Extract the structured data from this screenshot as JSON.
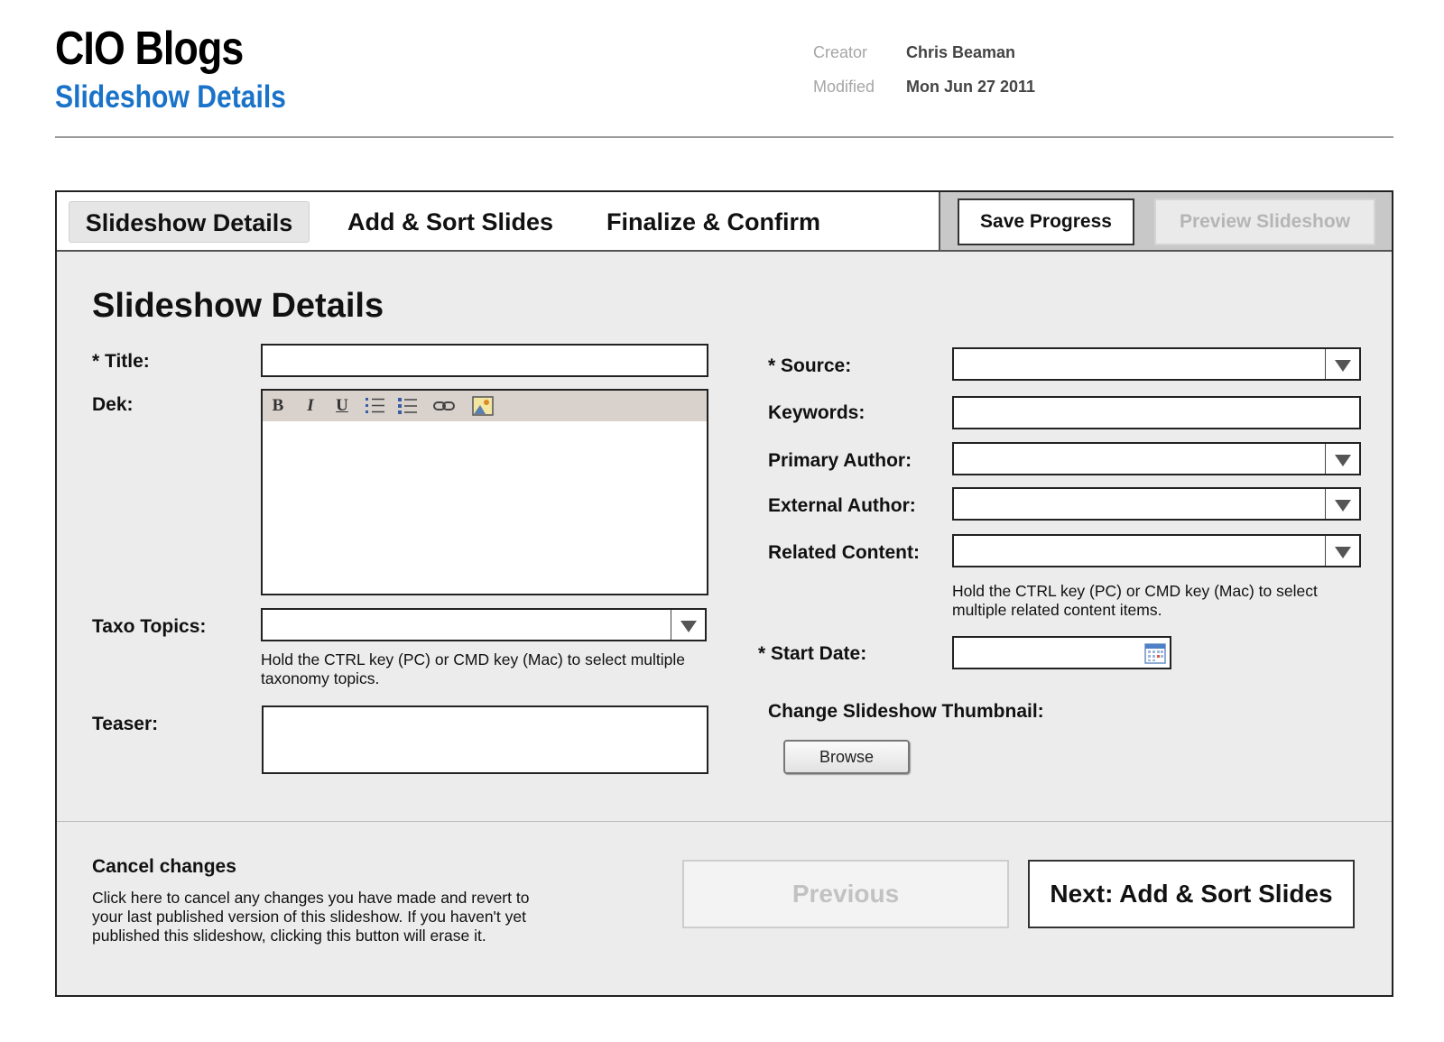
{
  "header": {
    "app_title": "CIO Blogs",
    "page_subtitle": "Slideshow Details",
    "meta": [
      {
        "label": "Creator",
        "value": "Chris Beaman"
      },
      {
        "label": "Modified",
        "value": "Mon Jun 27 2011"
      }
    ]
  },
  "tabs": [
    {
      "label": "Slideshow Details",
      "active": true
    },
    {
      "label": "Add & Sort Slides",
      "active": false
    },
    {
      "label": "Finalize & Confirm",
      "active": false
    }
  ],
  "actions": {
    "save_label": "Save Progress",
    "preview_label": "Preview Slideshow"
  },
  "form": {
    "section_title": "Slideshow Details",
    "left": {
      "title_label": "* Title:",
      "dek_label": "Dek:",
      "rte_tools": {
        "bold": "B",
        "italic": "I",
        "underline": "U"
      },
      "taxo_label": "Taxo Topics:",
      "taxo_hint": "Hold the CTRL key (PC) or CMD key (Mac) to select multiple taxonomy topics.",
      "teaser_label": "Teaser:"
    },
    "right": {
      "source_label": "* Source:",
      "keywords_label": "Keywords:",
      "primary_author_label": "Primary Author:",
      "external_author_label": "External Author:",
      "related_content_label": "Related Content:",
      "related_hint": "Hold the CTRL key (PC) or CMD key (Mac) to select multiple related content items.",
      "start_date_label": "* Start Date:",
      "thumbnail_label": "Change Slideshow Thumbnail:",
      "browse_label": "Browse"
    }
  },
  "footer": {
    "cancel_title": "Cancel changes",
    "cancel_desc": "Click here to cancel any changes you have made and revert to your last published version of this slideshow. If you haven't yet published this slideshow, clicking this button will erase it.",
    "previous_label": "Previous",
    "next_label": "Next: Add & Sort Slides"
  },
  "colors": {
    "subtitle_blue": "#1a73c9",
    "panel_bg": "#ececec",
    "disabled_text": "#b5b5b5"
  }
}
